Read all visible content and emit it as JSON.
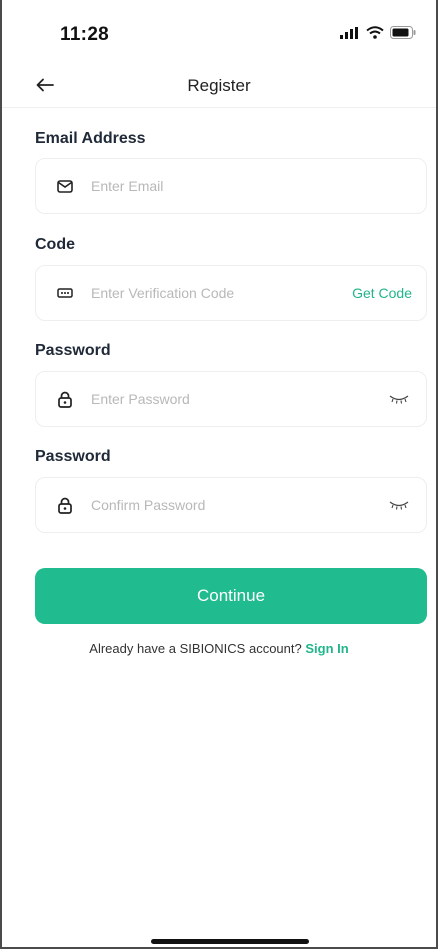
{
  "status_bar": {
    "time": "11:28"
  },
  "nav": {
    "title": "Register"
  },
  "form": {
    "email": {
      "label": "Email Address",
      "placeholder": "Enter Email",
      "value": ""
    },
    "code": {
      "label": "Code",
      "placeholder": "Enter Verification Code",
      "value": "",
      "action": "Get Code"
    },
    "password": {
      "label": "Password",
      "placeholder": "Enter Password",
      "value": ""
    },
    "confirm": {
      "label": "Password",
      "placeholder": "Confirm Password",
      "value": ""
    }
  },
  "actions": {
    "continue_label": "Continue"
  },
  "signin": {
    "prompt": "Already have a SIBIONICS account?",
    "link": "Sign In"
  },
  "icons": {
    "back": "back-arrow-icon",
    "email": "envelope-icon",
    "code": "keyboard-icon",
    "lock": "lock-icon",
    "eye": "eye-closed-icon"
  },
  "colors": {
    "accent": "#20bb8e",
    "link": "#21b58b",
    "placeholder": "#b8b8b8"
  }
}
